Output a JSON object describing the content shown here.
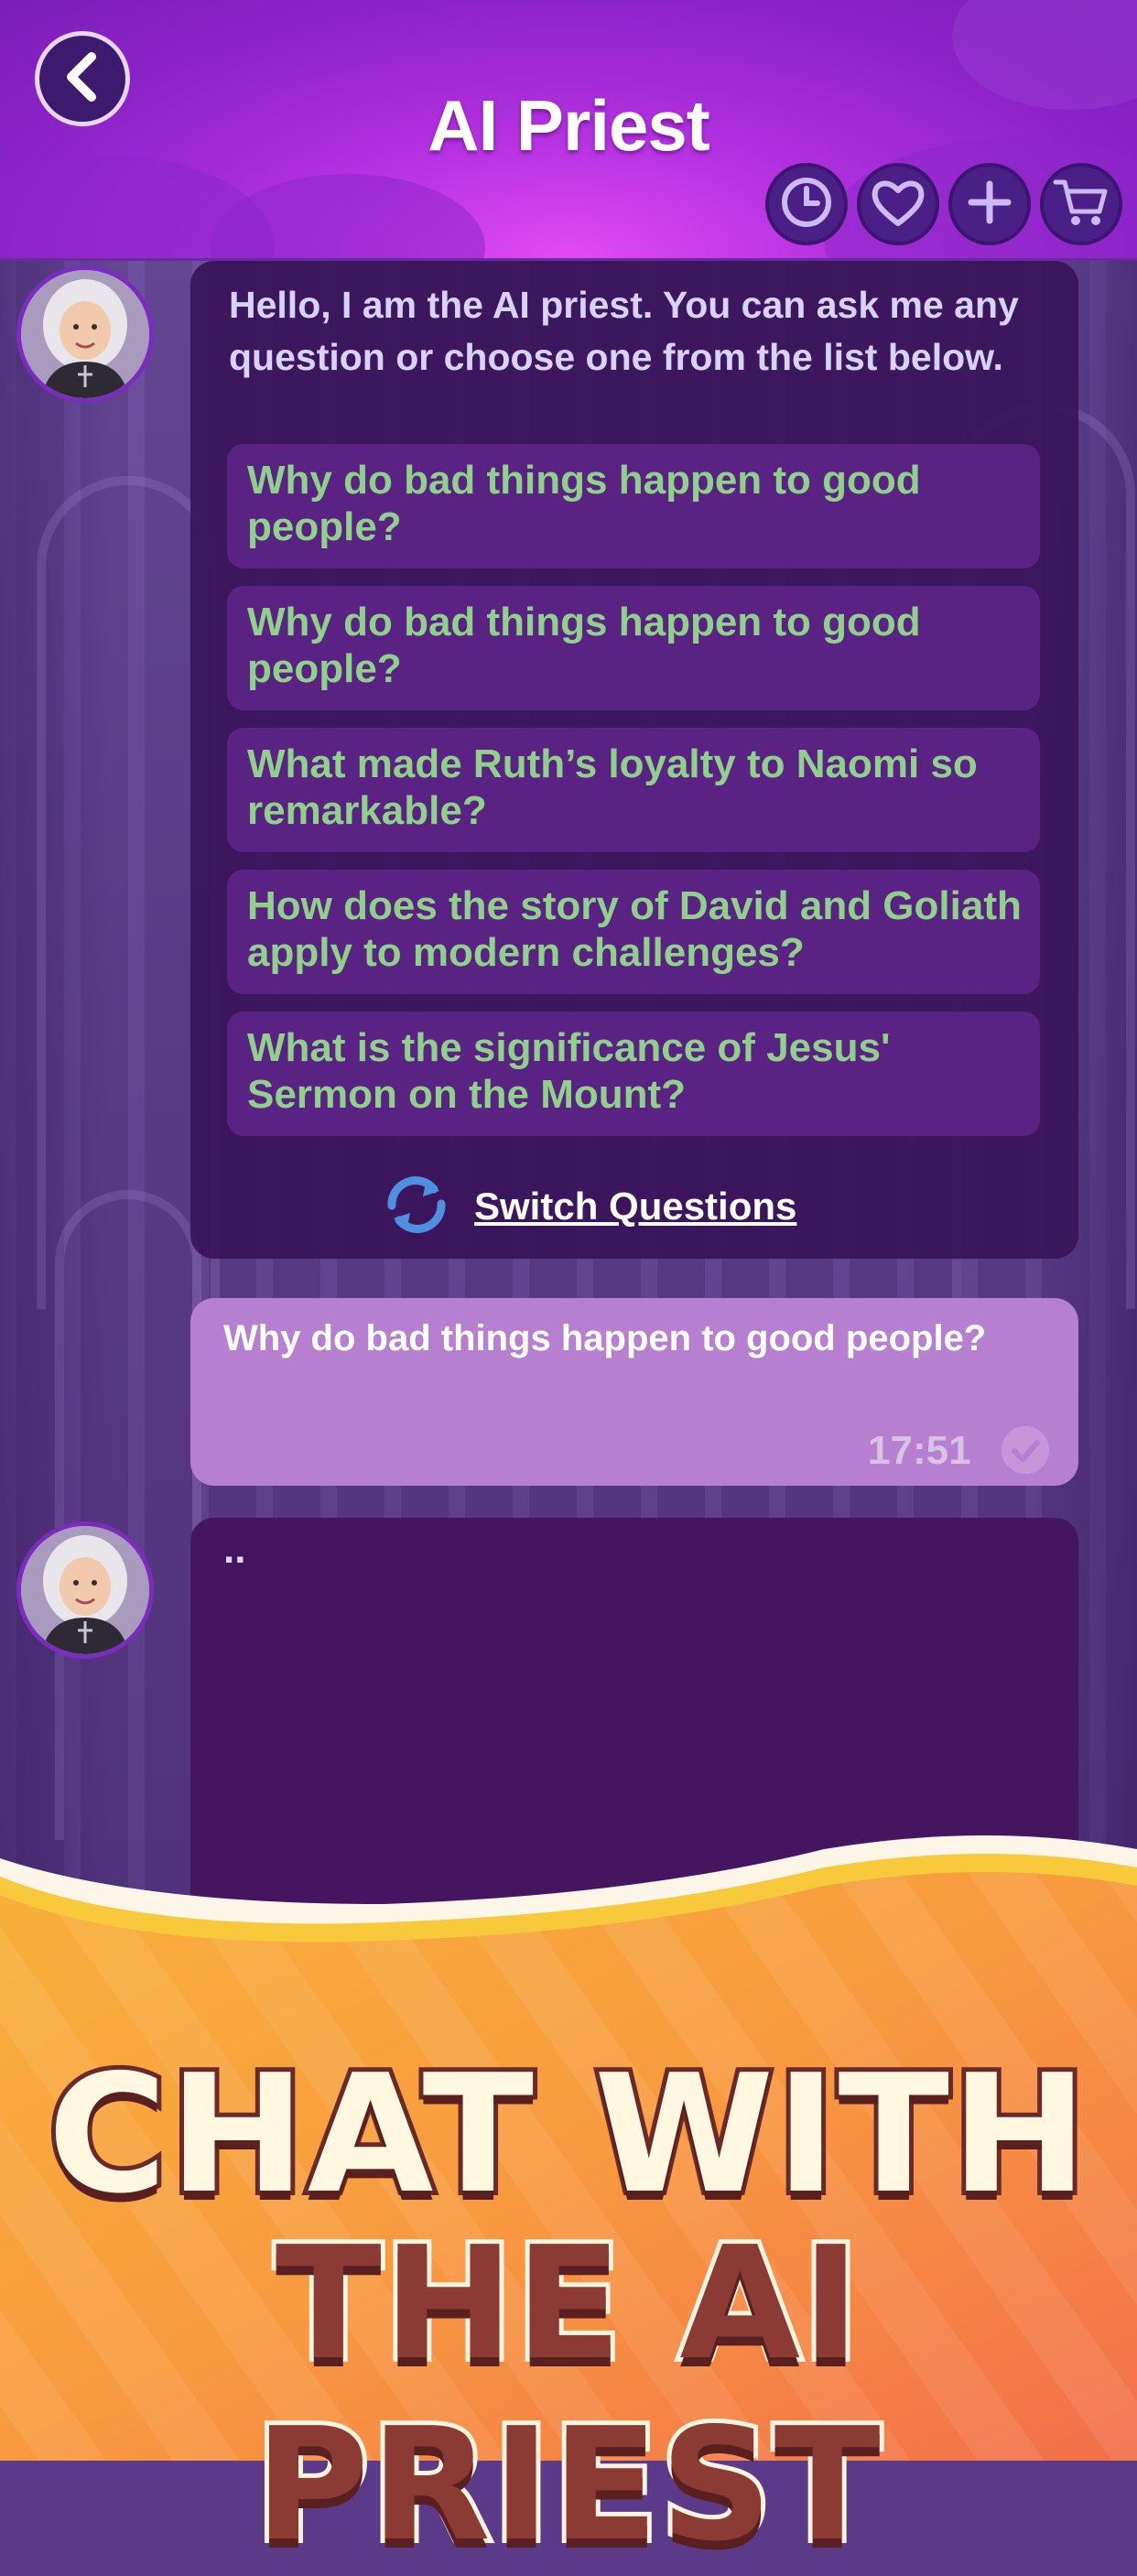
{
  "header": {
    "title": "AI Priest",
    "back_icon": "chevron-left-icon",
    "tools": [
      "history-icon",
      "heart-icon",
      "plus-icon",
      "cart-icon"
    ]
  },
  "chat": {
    "greeting": "Hello, I am the AI priest. You can ask me any question or choose one from the list below.",
    "suggestions": [
      "Why do bad things happen to good people?",
      "Why do bad things happen to good people?",
      "What made Ruth’s loyalty to Naomi so remarkable?",
      "How does the story of David and Goliath apply to modern challenges?",
      "What is the significance of Jesus' Sermon on the Mount?"
    ],
    "switch_label": "Switch Questions",
    "user_message": {
      "text": "Why do bad things happen to good people?",
      "time": "17:51"
    },
    "typing_indicator": ".."
  },
  "promo": {
    "line1": "CHAT WITH",
    "line2": "THE AI PRIEST"
  },
  "colors": {
    "header": "#b331e0",
    "question_text": "#8fd18a",
    "bot_bubble": "#3a145a",
    "user_bubble": "#b77fcf",
    "promo_orange": "#f7a33a"
  }
}
